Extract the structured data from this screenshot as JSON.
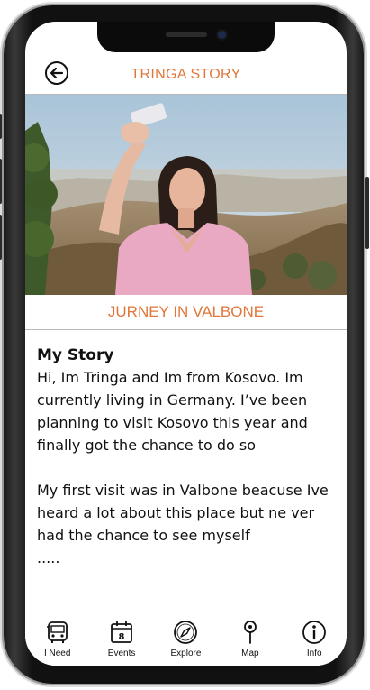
{
  "header": {
    "title": "TRINGA STORY",
    "back_icon": "arrow-left-circle-icon"
  },
  "hero": {
    "image": "woman taking selfie above city"
  },
  "subtitle": "JURNEY IN VALBONE",
  "story": {
    "heading": "My Story",
    "body": "Hi, Im Tringa and Im from Kosovo. Im currently living in Germany. I’ve been planning to visit Kosovo this year and finally got the chance to do so\n\nMy first visit was in Valbone beacuse Ive heard a lot about this place but ne ver had the chance to see myself\n....."
  },
  "tabs": [
    {
      "label": "I Need",
      "icon": "bus-icon"
    },
    {
      "label": "Events",
      "icon": "calendar-icon",
      "badge": "8"
    },
    {
      "label": "Explore",
      "icon": "compass-icon"
    },
    {
      "label": "Map",
      "icon": "map-pin-icon"
    },
    {
      "label": "Info",
      "icon": "info-icon"
    }
  ],
  "colors": {
    "accent": "#e0763a",
    "divider": "#b9b9b9"
  }
}
